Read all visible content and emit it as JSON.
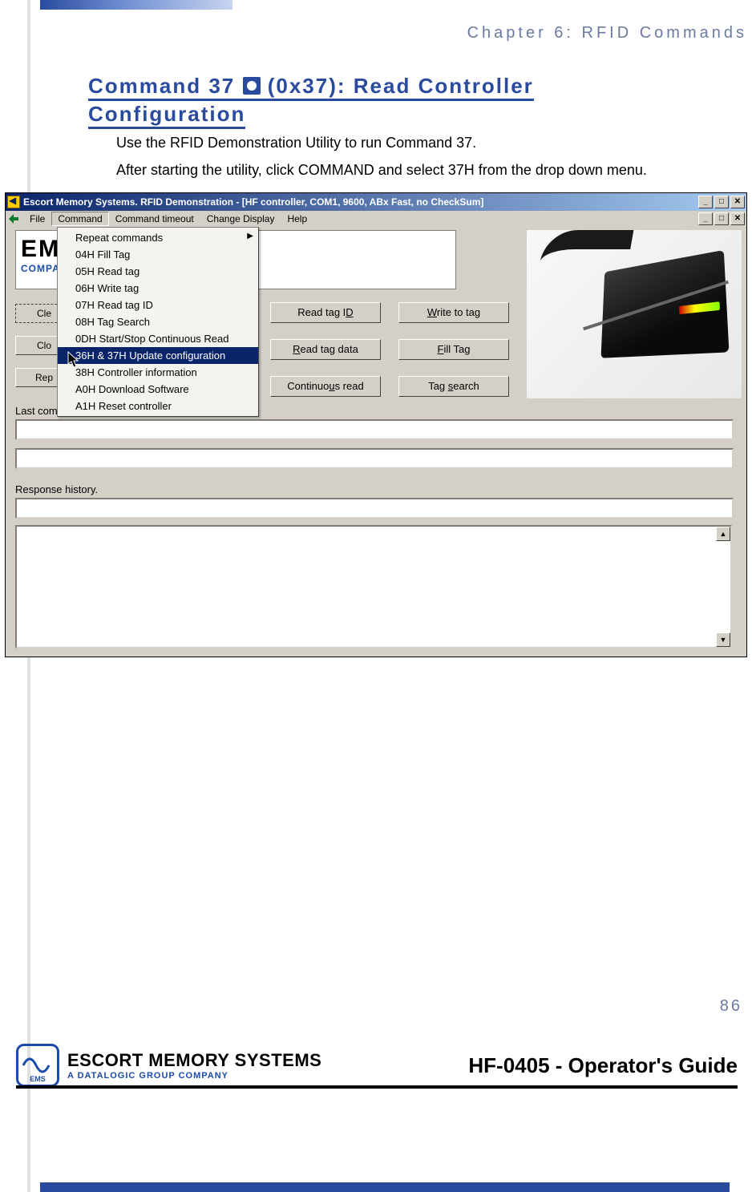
{
  "chapter": "Chapter 6: RFID Commands",
  "heading_part1": "Command 37 ",
  "heading_part2": " (0x37): Read Controller",
  "heading_line2": "Configuration",
  "body1": "Use the RFID Demonstration Utility to run Command 37.",
  "body2": "After starting the utility, click COMMAND and select 37H from the drop down menu.",
  "app": {
    "title": "Escort Memory Systems.   RFID Demonstration - [HF controller, COM1, 9600, ABx Fast, no CheckSum]",
    "menus": [
      "File",
      "Command",
      "Command timeout",
      "Change Display",
      "Help"
    ],
    "dropdown": [
      "Repeat commands",
      "04H Fill Tag",
      "05H Read tag",
      "06H Write tag",
      "07H Read tag ID",
      "08H Tag Search",
      "0DH Start/Stop Continuous Read",
      "36H & 37H Update configuration",
      "38H Controller information",
      "A0H Download Software",
      "A1H Reset controller"
    ],
    "dropdown_arrow_index": 0,
    "dropdown_selected_index": 7,
    "logo_big": "EMORY SYSTEMS",
    "logo_sub": "COMPANY",
    "side_buttons": [
      "Cle",
      "Clo",
      "Rep"
    ],
    "mid_buttons_col1_html": [
      "Read tag I<u>D</u>",
      "<u>R</u>ead tag data",
      "Continuo<u>u</u>s read"
    ],
    "mid_buttons_col2_html": [
      "<u>W</u>rite to tag",
      "<u>F</u>ill Tag",
      "Tag <u>s</u>earch"
    ],
    "label_last_cmd": "Last command transmitted",
    "label_resp": "Response history.",
    "win_min": "_",
    "win_max": "□",
    "win_close": "✕",
    "scroll_up": "▲",
    "scroll_dn": "▼"
  },
  "page_number": "86",
  "footer": {
    "company": "ESCORT MEMORY SYSTEMS",
    "tagline": "A DATALOGIC GROUP COMPANY",
    "ems": "EMS",
    "doc": "HF-0405 - Operator's Guide"
  }
}
